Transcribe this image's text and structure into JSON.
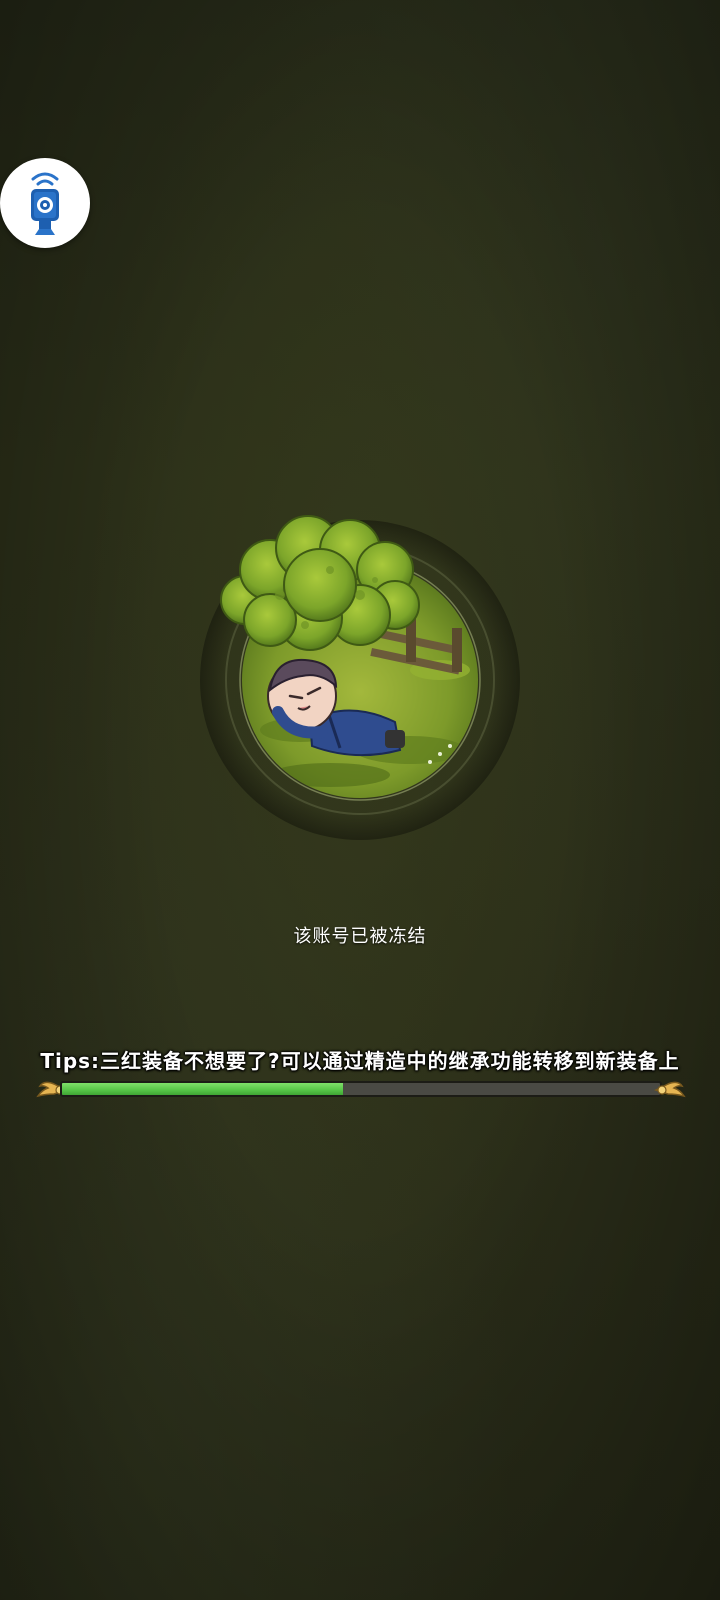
{
  "status": {
    "message": "该账号已被冻结"
  },
  "tips": {
    "text": "Tips:三红装备不想要了?可以通过精造中的继承功能转移到新装备上"
  },
  "progress": {
    "value": 0.47
  },
  "float_button": {
    "icon": "assistant-device-icon",
    "accent": "#2a73c9"
  },
  "colors": {
    "background": "#2a2d19",
    "progress_fill": "#56c447",
    "progress_track": "#4a4a44"
  }
}
